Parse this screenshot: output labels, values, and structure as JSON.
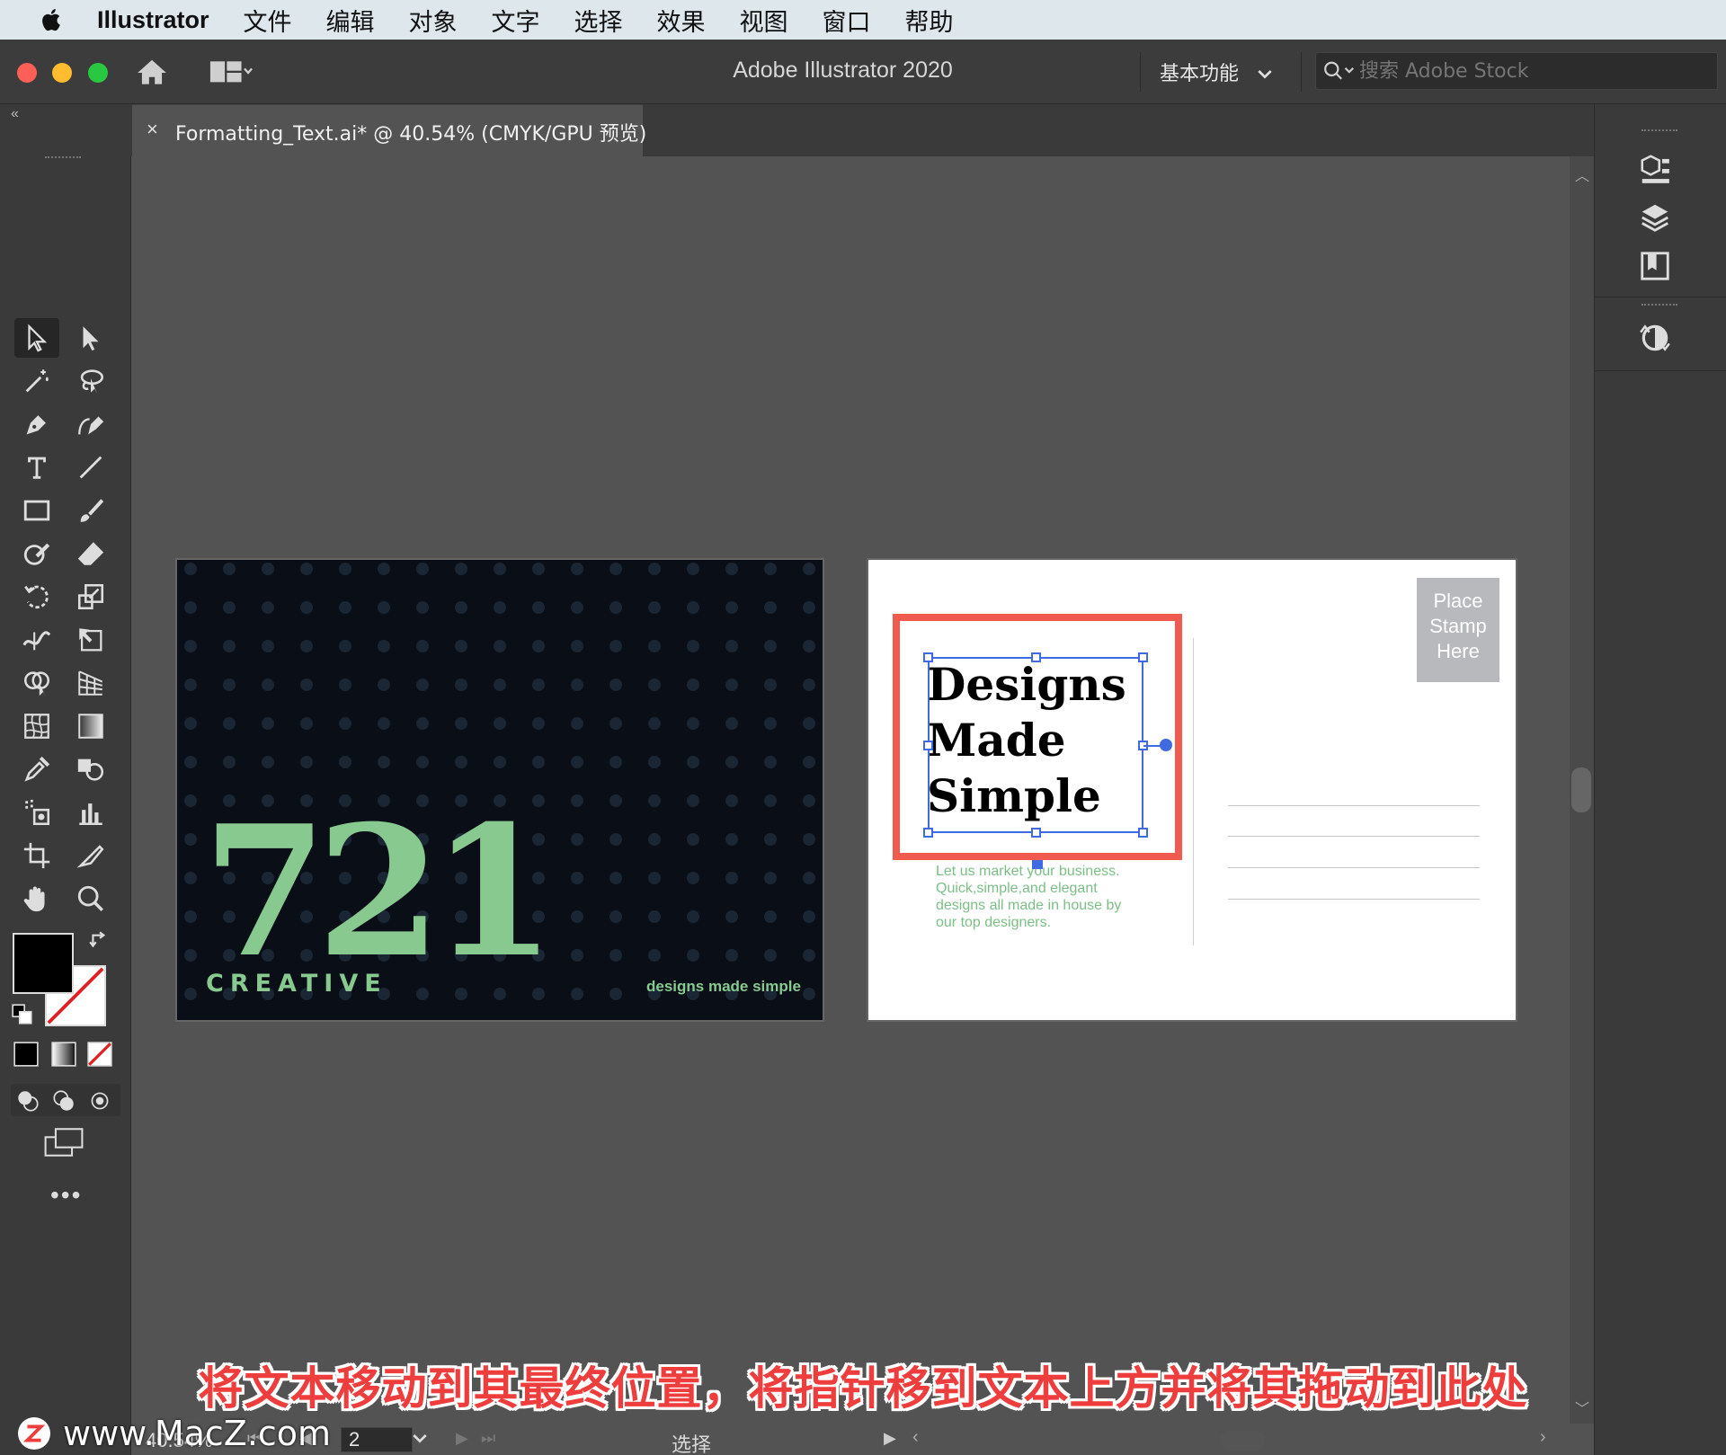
{
  "menubar": {
    "app_name": "Illustrator",
    "items": [
      "文件",
      "编辑",
      "对象",
      "文字",
      "选择",
      "效果",
      "视图",
      "窗口",
      "帮助"
    ]
  },
  "appbar": {
    "title": "Adobe Illustrator 2020",
    "workspace": "基本功能",
    "search_placeholder": "搜索 Adobe Stock"
  },
  "tab": {
    "close": "×",
    "label": "Formatting_Text.ai* @ 40.54% (CMYK/GPU 预览)"
  },
  "artboard1": {
    "number": "721",
    "creative": "CREATIVE",
    "tagline": "designs made simple"
  },
  "artboard2": {
    "stamp": [
      "Place",
      "Stamp",
      "Here"
    ],
    "headline": [
      "Designs",
      "Made",
      "Simple"
    ],
    "body": "Let us market your business. Quick,simple,and elegant designs all made in house by our top designers."
  },
  "caption": "将文本移动到其最终位置，将指针移到文本上方并将其拖动到此处",
  "statusbar": {
    "zoom": "40.54%",
    "page": "2",
    "tool": "选择"
  },
  "watermark": "www.MacZ.com",
  "colors": {
    "accent_green": "#87c98f",
    "highlight_red": "#f05a4f",
    "selection_blue": "#3f6ae0",
    "dark_bg": "#0a0f17"
  }
}
